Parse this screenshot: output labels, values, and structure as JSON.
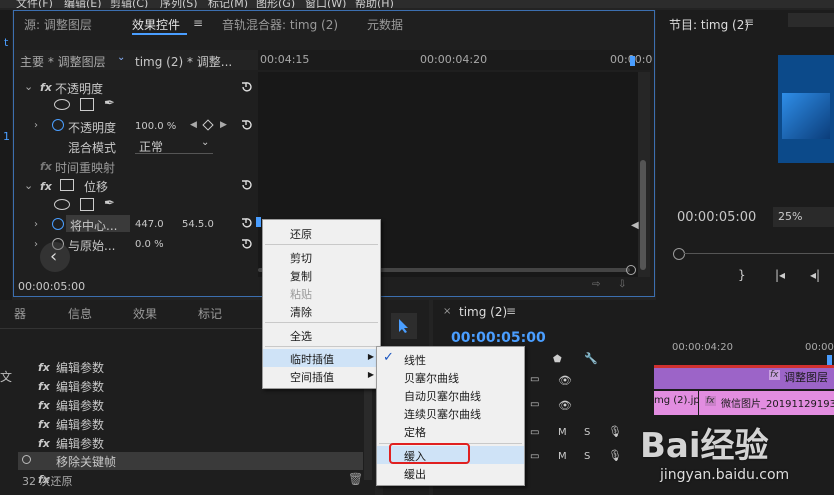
{
  "menubar": [
    "文件(F)",
    "编辑(E)",
    "剪辑(C)",
    "序列(S)",
    "标记(M)",
    "图形(G)",
    "窗口(W)",
    "帮助(H)"
  ],
  "top_tabs": {
    "source": "源: 调整图层",
    "effects": "效果控件",
    "audio_mixer": "音轨混合器: timg (2)",
    "metadata": "元数据"
  },
  "effect_controls": {
    "master_label": "主要 * 调整图层",
    "clip_label": "timg (2) * 调整...",
    "time1": "00:04:15",
    "time2": "00:00:04:20",
    "time3": "00:00:0",
    "opacity_header": "不透明度",
    "opacity_label": "不透明度",
    "opacity_value": "100.0 %",
    "blend_label": "混合模式",
    "blend_value": "正常",
    "timeremap_label": "时间重映射",
    "motion_label": "位移",
    "anchor_label": "将中心...",
    "anchor_x": "447.0",
    "anchor_y": "54.5.0",
    "scale_label": "与原始...",
    "scale_value": "0.0 %",
    "timecode": "00:00:05:00"
  },
  "program": {
    "title": "节目: timg (2)",
    "timecode": "00:00:05:00",
    "zoom": "25%"
  },
  "lower_tabs": {
    "t0": "器",
    "info": "信息",
    "effects": "效果",
    "markers": "标记"
  },
  "history": {
    "items": [
      "编辑参数",
      "编辑参数",
      "编辑参数",
      "编辑参数",
      "编辑参数",
      "移除关键帧",
      "编辑参数"
    ],
    "count": "32 次还原"
  },
  "timeline": {
    "title": "timg (2)",
    "timecode": "00:00:05:00",
    "ruler1": "00:00:04:20",
    "ruler2": "00:00:0",
    "clip_adjust": "调整图层",
    "clip_img1": "mg (2).jpg",
    "clip_img2": "微信图片_20191129193..."
  },
  "context_menu": {
    "items": [
      "还原",
      "剪切",
      "复制",
      "粘贴",
      "清除",
      "全选",
      "临时插值",
      "空间插值"
    ]
  },
  "submenu": {
    "items": [
      "线性",
      "贝塞尔曲线",
      "自动贝塞尔曲线",
      "连续贝塞尔曲线",
      "定格",
      "缓入",
      "缓出"
    ],
    "checked": "线性",
    "highlighted": "缓入"
  },
  "watermark": {
    "text": "Bai经验",
    "url": "jingyan.baidu.com"
  },
  "colors": {
    "accent": "#4a9eff",
    "highlight_red": "#e02020",
    "clip_pink": "#e28de0",
    "clip_purple": "#9c64c8"
  }
}
